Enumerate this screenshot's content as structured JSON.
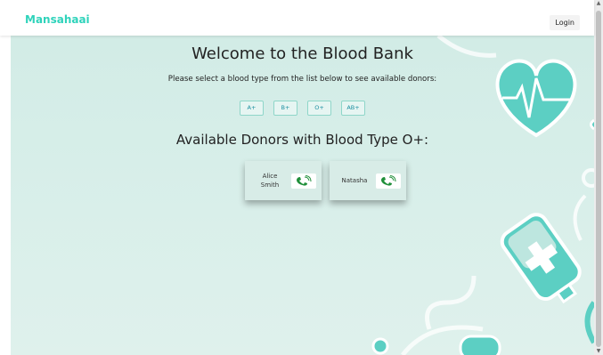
{
  "header": {
    "brand": "Mansahaai",
    "login_label": "Login"
  },
  "main": {
    "title": "Welcome to the Blood Bank",
    "subtitle": "Please select a blood type from the list below to see available donors:",
    "blood_types": [
      "A+",
      "B+",
      "O+",
      "AB+"
    ],
    "donors_title": "Available Donors with Blood Type O+:",
    "donors": [
      {
        "name": "Alice Smith",
        "action_icon": "phone-call-icon"
      },
      {
        "name": "Natasha",
        "action_icon": "phone-call-icon"
      }
    ]
  },
  "colors": {
    "brand": "#2fd3bb",
    "background": "#d2ece6",
    "accent_teal": "#5ccfc3",
    "phone_green": "#1f8f3a"
  }
}
